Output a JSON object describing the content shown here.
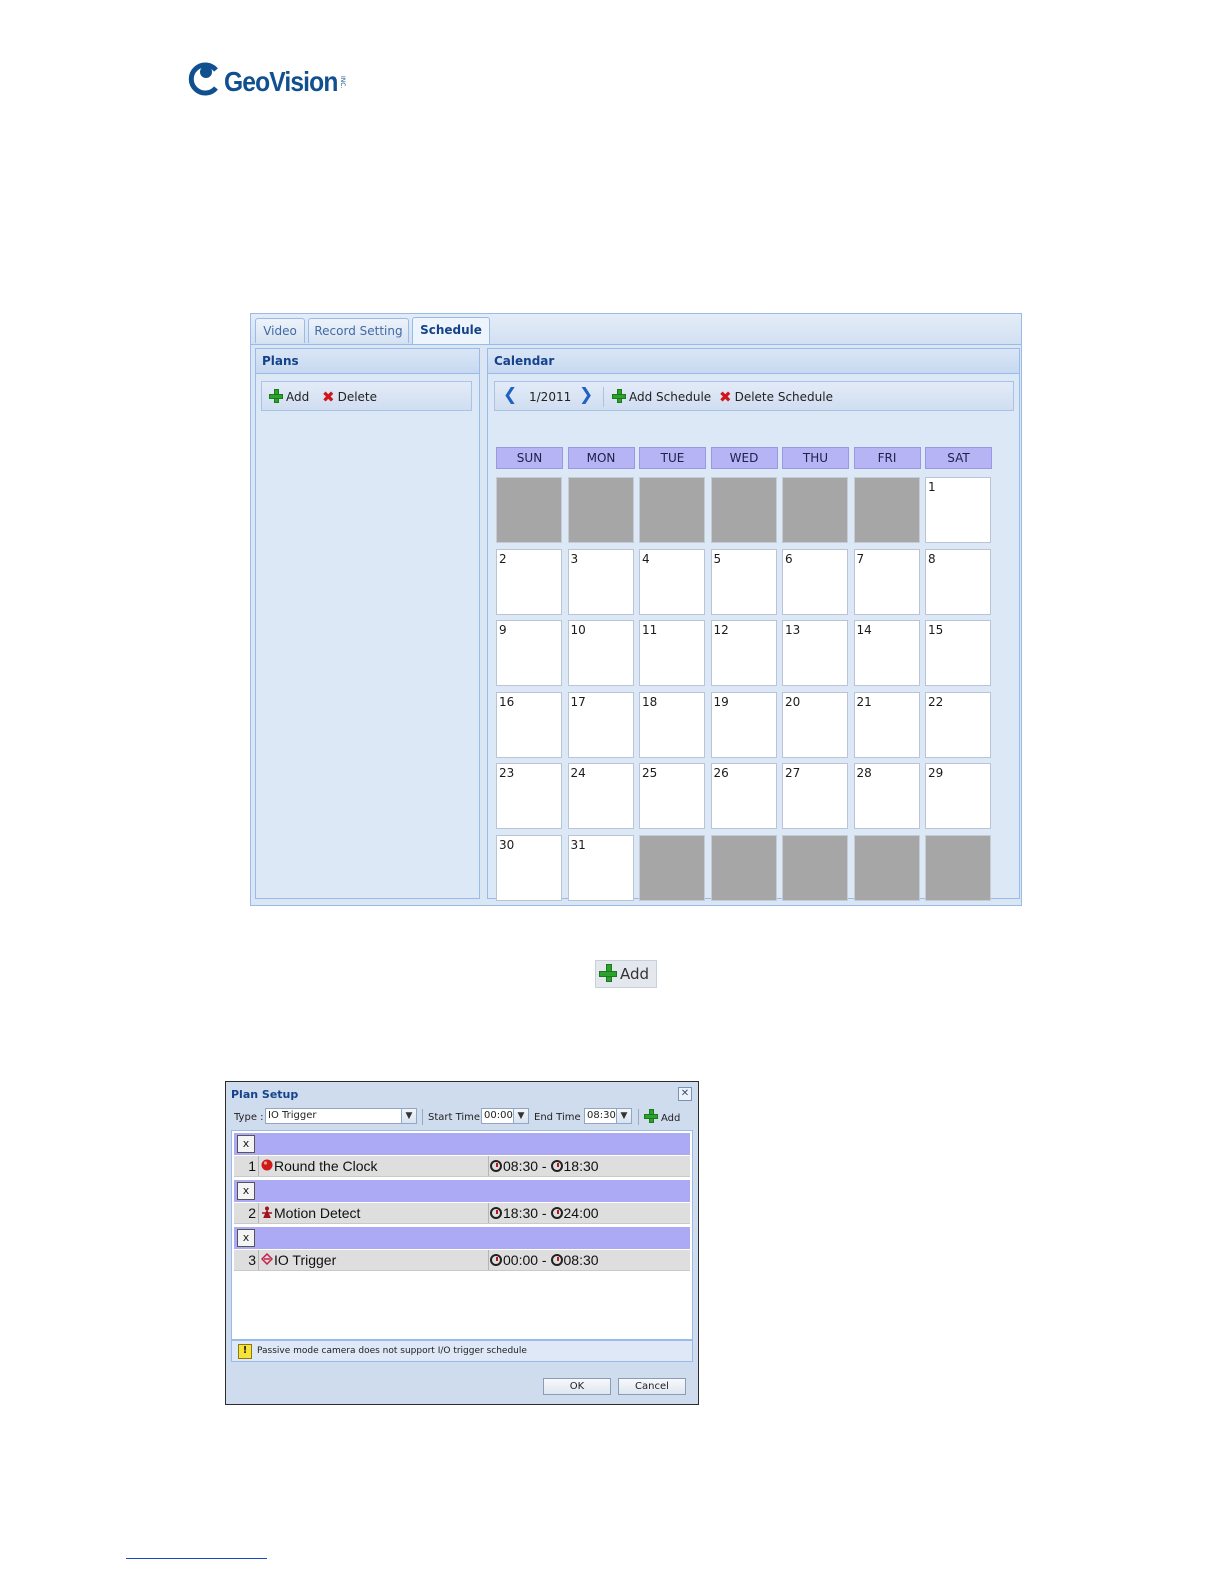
{
  "logo": {
    "text": "GeoVision",
    "tagline": "INC."
  },
  "schedule_window": {
    "tabs": [
      {
        "label": "Video",
        "active": false
      },
      {
        "label": "Record Setting",
        "active": false
      },
      {
        "label": "Schedule",
        "active": true
      }
    ],
    "plans_panel": {
      "title": "Plans",
      "add_label": "Add",
      "delete_label": "Delete"
    },
    "calendar_panel": {
      "title": "Calendar",
      "month": "1/2011",
      "add_schedule_label": "Add Schedule",
      "delete_schedule_label": "Delete Schedule",
      "weekdays": [
        "SUN",
        "MON",
        "TUE",
        "WED",
        "THU",
        "FRI",
        "SAT"
      ],
      "weeks": [
        [
          "",
          "",
          "",
          "",
          "",
          "",
          "1"
        ],
        [
          "2",
          "3",
          "4",
          "5",
          "6",
          "7",
          "8"
        ],
        [
          "9",
          "10",
          "11",
          "12",
          "13",
          "14",
          "15"
        ],
        [
          "16",
          "17",
          "18",
          "19",
          "20",
          "21",
          "22"
        ],
        [
          "23",
          "24",
          "25",
          "26",
          "27",
          "28",
          "29"
        ],
        [
          "30",
          "31",
          "",
          "",
          "",
          "",
          ""
        ]
      ]
    }
  },
  "add_button": {
    "label": "Add"
  },
  "plan_setup": {
    "title": "Plan Setup",
    "type_label": "Type :",
    "type_value": "IO Trigger",
    "start_label": "Start Time :",
    "start_value": "00:00",
    "end_label": "End Time :",
    "end_value": "08:30",
    "add_label": "Add",
    "remove_label": "x",
    "rows": [
      {
        "index": "1",
        "name": "Round the Clock",
        "start": "08:30",
        "end": "18:30",
        "icon": "record-dot-icon"
      },
      {
        "index": "2",
        "name": "Motion Detect",
        "start": "18:30",
        "end": "24:00",
        "icon": "motion-person-icon"
      },
      {
        "index": "3",
        "name": "IO Trigger",
        "start": "00:00",
        "end": "08:30",
        "icon": "io-trigger-icon"
      }
    ],
    "warning": "Passive mode camera does not support I/O trigger schedule",
    "ok_label": "OK",
    "cancel_label": "Cancel"
  },
  "colors": {
    "accent": "#15428b",
    "day_header": "#b7b4f6",
    "disabled_day": "#a6a6a6",
    "logo": "#10508f"
  }
}
